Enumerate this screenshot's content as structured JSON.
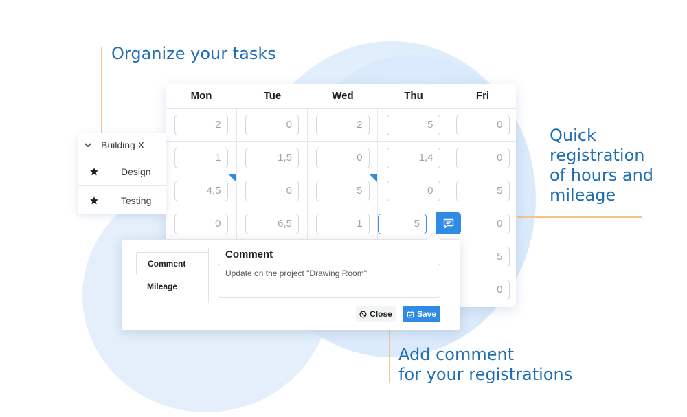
{
  "callouts": {
    "organize": "Organize your tasks",
    "quick": "Quick\nregistration\nof hours and\nmileage",
    "comment": "Add comment\nfor your registrations"
  },
  "grid": {
    "days": [
      "Mon",
      "Tue",
      "Wed",
      "Thu",
      "Fri"
    ],
    "rows": [
      [
        "2",
        "0",
        "2",
        "5",
        "0"
      ],
      [
        "1",
        "1,5",
        "0",
        "1,4",
        "0"
      ],
      [
        "4,5",
        "0",
        "5",
        "0",
        "5"
      ],
      [
        "0",
        "6,5",
        "1",
        "5",
        "0"
      ],
      [
        "",
        "",
        "",
        "",
        "5"
      ],
      [
        "",
        "",
        "",
        "",
        "0"
      ]
    ]
  },
  "tasks": {
    "group": "Building X",
    "items": [
      "Design",
      "Testing"
    ]
  },
  "popup": {
    "tabs": [
      "Comment",
      "Mileage"
    ],
    "title": "Comment",
    "text": "Update on the project \"Drawing Room\"",
    "close_label": "Close",
    "save_label": "Save"
  },
  "colors": {
    "accent": "#2f8be3",
    "callout": "#1f6fb2",
    "line": "#f4c391"
  }
}
